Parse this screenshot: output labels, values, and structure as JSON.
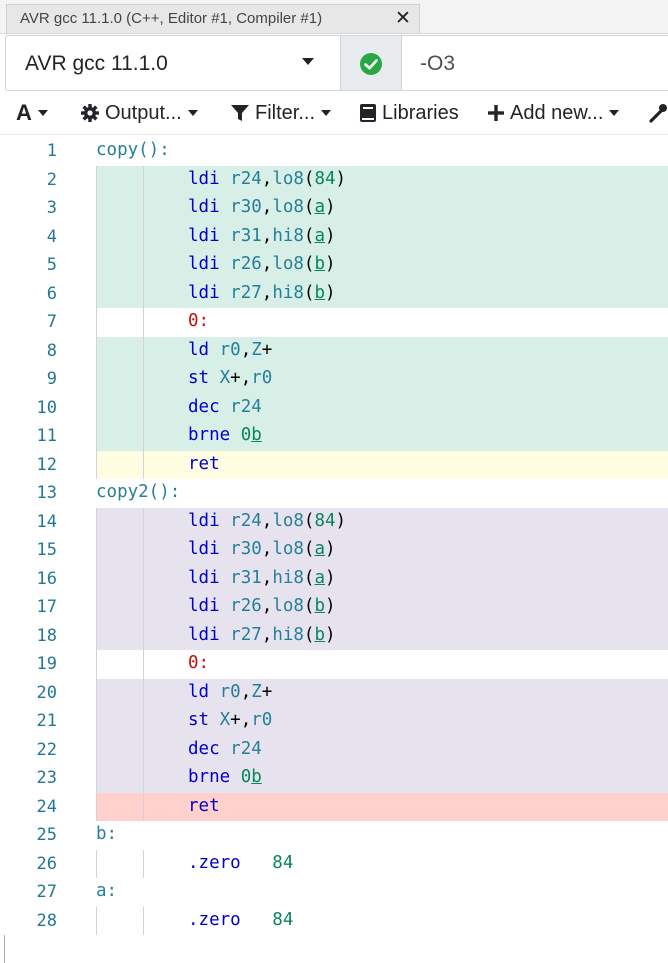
{
  "tab": {
    "title": "AVR gcc 11.1.0 (C++, Editor #1, Compiler #1)",
    "close_icon": "close-icon"
  },
  "compiler": {
    "name": "AVR gcc 11.1.0",
    "status_icon": "check-circle-icon",
    "status_color": "#28a745",
    "options": "-O3"
  },
  "toolbar": {
    "font_label": "A",
    "output_label": "Output...",
    "filter_label": "Filter...",
    "libraries_label": "Libraries",
    "add_new_label": "Add new..."
  },
  "colors": {
    "green": "#d8efe8",
    "yellow": "#fefde2",
    "purple": "#e6e3ef",
    "red": "#ffd0cc"
  },
  "lines": [
    {
      "n": "1",
      "bg": "none",
      "indent": 0,
      "toks": [
        [
          "lbl",
          "copy():"
        ]
      ]
    },
    {
      "n": "2",
      "bg": "green",
      "indent": 2,
      "toks": [
        [
          "kw",
          "ldi "
        ],
        [
          "reg",
          "r24"
        ],
        [
          "pun",
          ","
        ],
        [
          "reg",
          "lo8"
        ],
        [
          "pun",
          "("
        ],
        [
          "num",
          "84"
        ],
        [
          "pun",
          ")"
        ]
      ]
    },
    {
      "n": "3",
      "bg": "green",
      "indent": 2,
      "toks": [
        [
          "kw",
          "ldi "
        ],
        [
          "reg",
          "r30"
        ],
        [
          "pun",
          ","
        ],
        [
          "reg",
          "lo8"
        ],
        [
          "pun",
          "("
        ],
        [
          "ref",
          "a"
        ],
        [
          "pun",
          ")"
        ]
      ]
    },
    {
      "n": "4",
      "bg": "green",
      "indent": 2,
      "toks": [
        [
          "kw",
          "ldi "
        ],
        [
          "reg",
          "r31"
        ],
        [
          "pun",
          ","
        ],
        [
          "reg",
          "hi8"
        ],
        [
          "pun",
          "("
        ],
        [
          "ref",
          "a"
        ],
        [
          "pun",
          ")"
        ]
      ]
    },
    {
      "n": "5",
      "bg": "green",
      "indent": 2,
      "toks": [
        [
          "kw",
          "ldi "
        ],
        [
          "reg",
          "r26"
        ],
        [
          "pun",
          ","
        ],
        [
          "reg",
          "lo8"
        ],
        [
          "pun",
          "("
        ],
        [
          "ref",
          "b"
        ],
        [
          "pun",
          ")"
        ]
      ]
    },
    {
      "n": "6",
      "bg": "green",
      "indent": 2,
      "toks": [
        [
          "kw",
          "ldi "
        ],
        [
          "reg",
          "r27"
        ],
        [
          "pun",
          ","
        ],
        [
          "reg",
          "hi8"
        ],
        [
          "pun",
          "("
        ],
        [
          "ref",
          "b"
        ],
        [
          "pun",
          ")"
        ]
      ]
    },
    {
      "n": "7",
      "bg": "none",
      "indent": 2,
      "toks": [
        [
          "loclbl",
          "0:"
        ]
      ]
    },
    {
      "n": "8",
      "bg": "green",
      "indent": 2,
      "toks": [
        [
          "kw",
          "ld "
        ],
        [
          "reg",
          "r0"
        ],
        [
          "pun",
          ","
        ],
        [
          "reg",
          "Z"
        ],
        [
          "pun",
          "+"
        ]
      ]
    },
    {
      "n": "9",
      "bg": "green",
      "indent": 2,
      "toks": [
        [
          "kw",
          "st "
        ],
        [
          "reg",
          "X"
        ],
        [
          "pun",
          "+,"
        ],
        [
          "reg",
          "r0"
        ]
      ]
    },
    {
      "n": "10",
      "bg": "green",
      "indent": 2,
      "toks": [
        [
          "kw",
          "dec "
        ],
        [
          "reg",
          "r24"
        ]
      ]
    },
    {
      "n": "11",
      "bg": "green",
      "indent": 2,
      "toks": [
        [
          "kw",
          "brne "
        ],
        [
          "num",
          "0"
        ],
        [
          "ref",
          "b"
        ]
      ]
    },
    {
      "n": "12",
      "bg": "yellow",
      "indent": 2,
      "toks": [
        [
          "kw",
          "ret"
        ]
      ]
    },
    {
      "n": "13",
      "bg": "none",
      "indent": 0,
      "toks": [
        [
          "lbl",
          "copy2():"
        ]
      ]
    },
    {
      "n": "14",
      "bg": "purple",
      "indent": 2,
      "toks": [
        [
          "kw",
          "ldi "
        ],
        [
          "reg",
          "r24"
        ],
        [
          "pun",
          ","
        ],
        [
          "reg",
          "lo8"
        ],
        [
          "pun",
          "("
        ],
        [
          "num",
          "84"
        ],
        [
          "pun",
          ")"
        ]
      ]
    },
    {
      "n": "15",
      "bg": "purple",
      "indent": 2,
      "toks": [
        [
          "kw",
          "ldi "
        ],
        [
          "reg",
          "r30"
        ],
        [
          "pun",
          ","
        ],
        [
          "reg",
          "lo8"
        ],
        [
          "pun",
          "("
        ],
        [
          "ref",
          "a"
        ],
        [
          "pun",
          ")"
        ]
      ]
    },
    {
      "n": "16",
      "bg": "purple",
      "indent": 2,
      "toks": [
        [
          "kw",
          "ldi "
        ],
        [
          "reg",
          "r31"
        ],
        [
          "pun",
          ","
        ],
        [
          "reg",
          "hi8"
        ],
        [
          "pun",
          "("
        ],
        [
          "ref",
          "a"
        ],
        [
          "pun",
          ")"
        ]
      ]
    },
    {
      "n": "17",
      "bg": "purple",
      "indent": 2,
      "toks": [
        [
          "kw",
          "ldi "
        ],
        [
          "reg",
          "r26"
        ],
        [
          "pun",
          ","
        ],
        [
          "reg",
          "lo8"
        ],
        [
          "pun",
          "("
        ],
        [
          "ref",
          "b"
        ],
        [
          "pun",
          ")"
        ]
      ]
    },
    {
      "n": "18",
      "bg": "purple",
      "indent": 2,
      "toks": [
        [
          "kw",
          "ldi "
        ],
        [
          "reg",
          "r27"
        ],
        [
          "pun",
          ","
        ],
        [
          "reg",
          "hi8"
        ],
        [
          "pun",
          "("
        ],
        [
          "ref",
          "b"
        ],
        [
          "pun",
          ")"
        ]
      ]
    },
    {
      "n": "19",
      "bg": "none",
      "indent": 2,
      "toks": [
        [
          "loclbl",
          "0:"
        ]
      ]
    },
    {
      "n": "20",
      "bg": "purple",
      "indent": 2,
      "toks": [
        [
          "kw",
          "ld "
        ],
        [
          "reg",
          "r0"
        ],
        [
          "pun",
          ","
        ],
        [
          "reg",
          "Z"
        ],
        [
          "pun",
          "+"
        ]
      ]
    },
    {
      "n": "21",
      "bg": "purple",
      "indent": 2,
      "toks": [
        [
          "kw",
          "st "
        ],
        [
          "reg",
          "X"
        ],
        [
          "pun",
          "+,"
        ],
        [
          "reg",
          "r0"
        ]
      ]
    },
    {
      "n": "22",
      "bg": "purple",
      "indent": 2,
      "toks": [
        [
          "kw",
          "dec "
        ],
        [
          "reg",
          "r24"
        ]
      ]
    },
    {
      "n": "23",
      "bg": "purple",
      "indent": 2,
      "toks": [
        [
          "kw",
          "brne "
        ],
        [
          "num",
          "0"
        ],
        [
          "ref",
          "b"
        ]
      ]
    },
    {
      "n": "24",
      "bg": "red",
      "indent": 2,
      "toks": [
        [
          "kw",
          "ret"
        ]
      ]
    },
    {
      "n": "25",
      "bg": "none",
      "indent": 0,
      "toks": [
        [
          "lbl",
          "b:"
        ]
      ]
    },
    {
      "n": "26",
      "bg": "none",
      "indent": 2,
      "toks": [
        [
          "kw",
          ".zero   "
        ],
        [
          "num",
          "84"
        ]
      ]
    },
    {
      "n": "27",
      "bg": "none",
      "indent": 0,
      "toks": [
        [
          "lbl",
          "a:"
        ]
      ]
    },
    {
      "n": "28",
      "bg": "none",
      "indent": 2,
      "toks": [
        [
          "kw",
          ".zero   "
        ],
        [
          "num",
          "84"
        ]
      ]
    }
  ]
}
